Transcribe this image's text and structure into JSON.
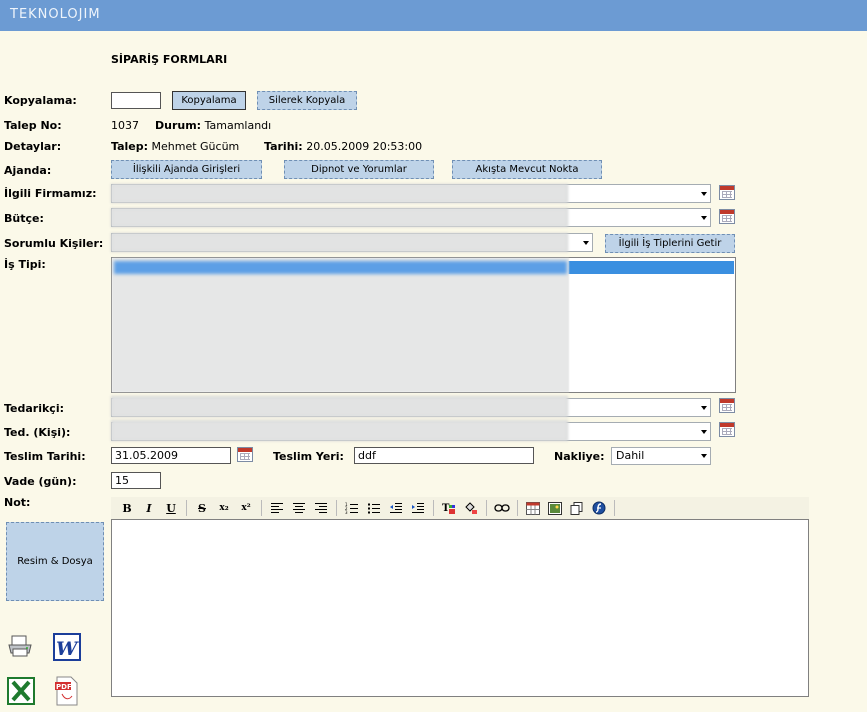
{
  "header": {
    "brand": "TEKNOLOJIM"
  },
  "page_title": "SİPARİŞ FORMLARI",
  "kopyalama": {
    "label": "Kopyalama:",
    "input_value": "",
    "copy_button": "Kopyalama",
    "copy_delete_button": "Silerek Kopyala"
  },
  "talep": {
    "label": "Talep No:",
    "no": "1037",
    "durum_label": "Durum:",
    "durum_value": "Tamamlandı"
  },
  "detaylar": {
    "label": "Detaylar:",
    "talep_label": "Talep:",
    "talep_value": "Mehmet Gücüm",
    "tarih_label": "Tarihi:",
    "tarih_value": "20.05.2009 20:53:00"
  },
  "ajanda": {
    "label": "Ajanda:",
    "buttons": [
      "İlişkili Ajanda Girişleri",
      "Dipnot ve Yorumlar",
      "Akışta Mevcut Nokta"
    ]
  },
  "fields": {
    "ilgili_firma_label": "İlgili Firmamız:",
    "butce_label": "Bütçe:",
    "sorumlu_label": "Sorumlu Kişiler:",
    "sorumlu_button": "İlgili İş Tiplerini Getir",
    "is_tipi_label": "İş Tipi:",
    "tedarikci_label": "Tedarikçi:",
    "ted_kisi_label": "Ted. (Kişi):"
  },
  "teslim": {
    "tarih_label": "Teslim Tarihi:",
    "tarih_value": "31.05.2009",
    "yer_label": "Teslim Yeri:",
    "yer_value": "ddf",
    "nakliye_label": "Nakliye:",
    "nakliye_value": "Dahil"
  },
  "vade": {
    "label": "Vade (gün):",
    "value": "15"
  },
  "not": {
    "label": "Not:"
  },
  "attachments_button": "Resim & Dosya",
  "toolbar": {
    "bold": "B",
    "italic": "I",
    "underline": "U",
    "strike": "S",
    "subscript": "x₂",
    "superscript": "x²"
  }
}
